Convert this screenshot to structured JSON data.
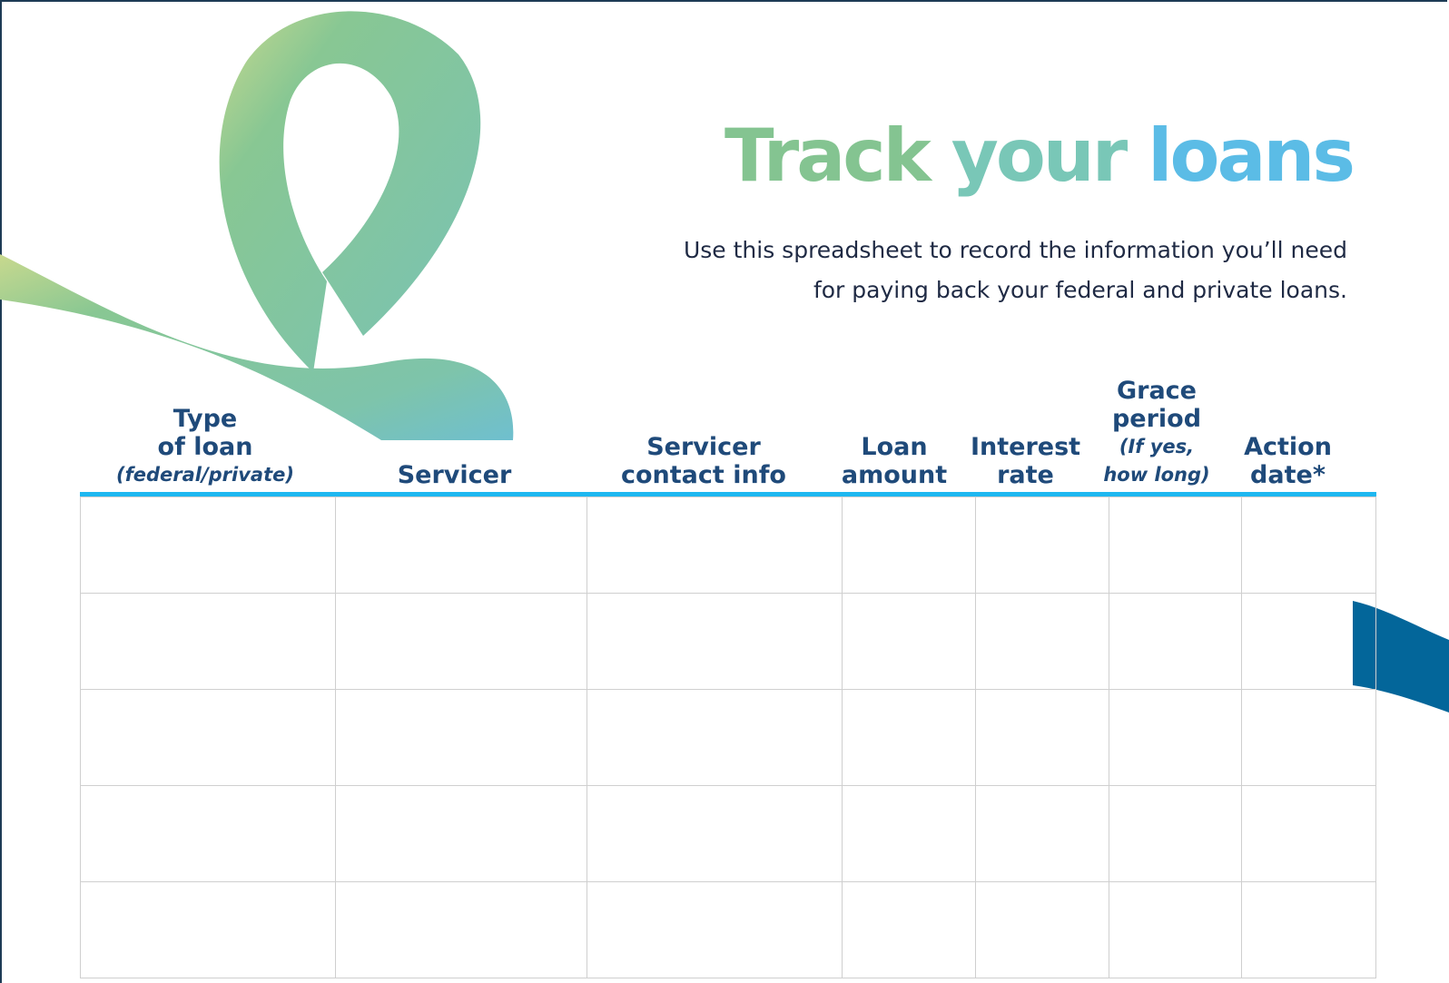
{
  "title": {
    "word1": "Track",
    "word2": "your",
    "word3": "loans"
  },
  "intro": {
    "line1": "Use this spreadsheet to record the information you’ll need",
    "line2": "for paying back your federal and private loans."
  },
  "columns": [
    {
      "lines": [
        "Type",
        "of loan"
      ],
      "note": "(federal/private)"
    },
    {
      "lines": [
        "Servicer"
      ],
      "note": ""
    },
    {
      "lines": [
        "Servicer",
        "contact info"
      ],
      "note": ""
    },
    {
      "lines": [
        "Loan",
        "amount"
      ],
      "note": ""
    },
    {
      "lines": [
        "Interest",
        "rate"
      ],
      "note": ""
    },
    {
      "lines": [
        "Grace",
        "period"
      ],
      "note": "(If yes,",
      "note2": "how long)"
    },
    {
      "lines": [
        "Action",
        "date*"
      ],
      "note": ""
    }
  ],
  "colors": {
    "title_green": "#84c491",
    "title_teal": "#79c7b7",
    "title_blue": "#5bbce6",
    "header_text": "#1f4a7a",
    "rule": "#1eb7f0",
    "ribbon_green": "#86c795",
    "ribbon_teal": "#78c2bf",
    "ribbon_blue": "#03669a"
  }
}
